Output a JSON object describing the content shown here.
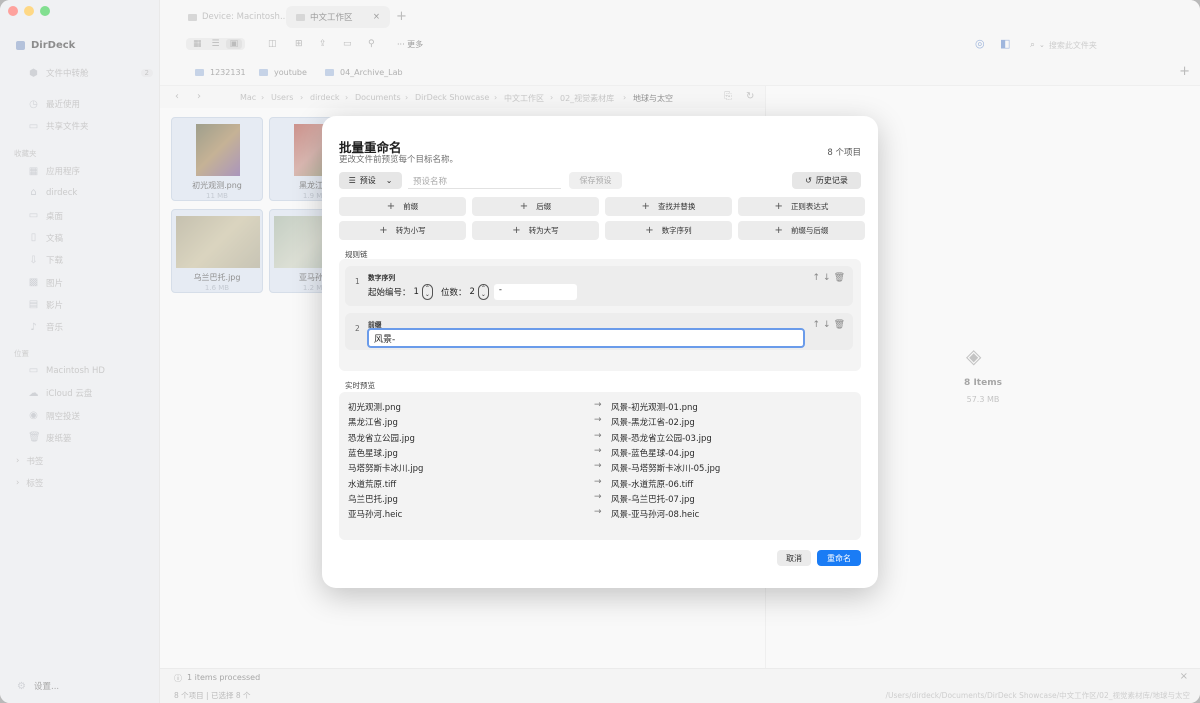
{
  "window": {
    "traffic_light_colors": [
      "#fe5f57",
      "#febc2e",
      "#28c840"
    ]
  },
  "sidebar": {
    "app_name": "DirDeck",
    "transfer": {
      "label": "文件中转舱",
      "badge": "2"
    },
    "recents": "最近使用",
    "shared": "共享文件夹",
    "favorites_title": "收藏夹",
    "favorites": [
      "应用程序",
      "dirdeck",
      "桌面",
      "文稿",
      "下载",
      "图片",
      "影片",
      "音乐"
    ],
    "locations_title": "位置",
    "locations": [
      "Macintosh HD",
      "iCloud 云盘",
      "隔空投送",
      "废纸篓"
    ],
    "bookmarks": "书签",
    "tags": "标签",
    "settings": "设置..."
  },
  "tabs": [
    {
      "label": "Device: Macintosh..."
    },
    {
      "label": "中文工作区"
    }
  ],
  "toolbar": {
    "more": "更多",
    "search_placeholder": "搜索此文件夹"
  },
  "favbar": [
    "1232131",
    "youtube",
    "04_Archive_Lab"
  ],
  "breadcrumb": [
    "Mac",
    "Users",
    "dirdeck",
    "Documents",
    "DirDeck Showcase",
    "中文工作区",
    "02_视觉素材库",
    "地球与太空"
  ],
  "files": [
    {
      "name": "初光观测.png",
      "size": "11 MB"
    },
    {
      "name": "黑龙江省",
      "size": "1.9 MB"
    },
    {
      "name": "乌兰巴托.jpg",
      "size": "1.6 MB"
    },
    {
      "name": "亚马孙河",
      "size": "1.2 MB"
    }
  ],
  "inspector": {
    "items": "8 Items",
    "size": "57.3 MB"
  },
  "status": {
    "processed": "1 items processed",
    "counts": "8 个项目 | 已选择 8 个",
    "path": "/Users/dirdeck/Documents/DirDeck Showcase/中文工作区/02_视觉素材库/地球与太空"
  },
  "dialog": {
    "title": "批量重命名",
    "subtitle": "更改文件前预览每个目标名称。",
    "count": "8 个项目",
    "preset_button": "预设",
    "preset_placeholder": "预设名称",
    "save_preset": "保存预设",
    "history": "历史记录",
    "actions": [
      "前缀",
      "后缀",
      "查找并替换",
      "正则表达式",
      "转为小写",
      "转为大写",
      "数字序列",
      "前缀与后缀"
    ],
    "rules_title": "规则链",
    "rules": [
      {
        "index": "1",
        "name": "数字序列",
        "start_label": "起始编号：",
        "start_value": "1",
        "digits_label": "位数：",
        "digits_value": "2",
        "separator": "-"
      },
      {
        "index": "2",
        "name": "前缀",
        "value": "风景-"
      }
    ],
    "preview_title": "实时预览",
    "preview": [
      {
        "old": "初光观测.png",
        "new": "风景-初光观测-01.png"
      },
      {
        "old": "黑龙江省.jpg",
        "new": "风景-黑龙江省-02.jpg"
      },
      {
        "old": "恐龙省立公园.jpg",
        "new": "风景-恐龙省立公园-03.jpg"
      },
      {
        "old": "蓝色星球.jpg",
        "new": "风景-蓝色星球-04.jpg"
      },
      {
        "old": "马塔努斯卡冰川.jpg",
        "new": "风景-马塔努斯卡冰川-05.jpg"
      },
      {
        "old": "水道荒原.tiff",
        "new": "风景-水道荒原-06.tiff"
      },
      {
        "old": "乌兰巴托.jpg",
        "new": "风景-乌兰巴托-07.jpg"
      },
      {
        "old": "亚马孙河.heic",
        "new": "风景-亚马孙河-08.heic"
      }
    ],
    "cancel": "取消",
    "confirm": "重命名",
    "accent": "#1a7cf5"
  }
}
